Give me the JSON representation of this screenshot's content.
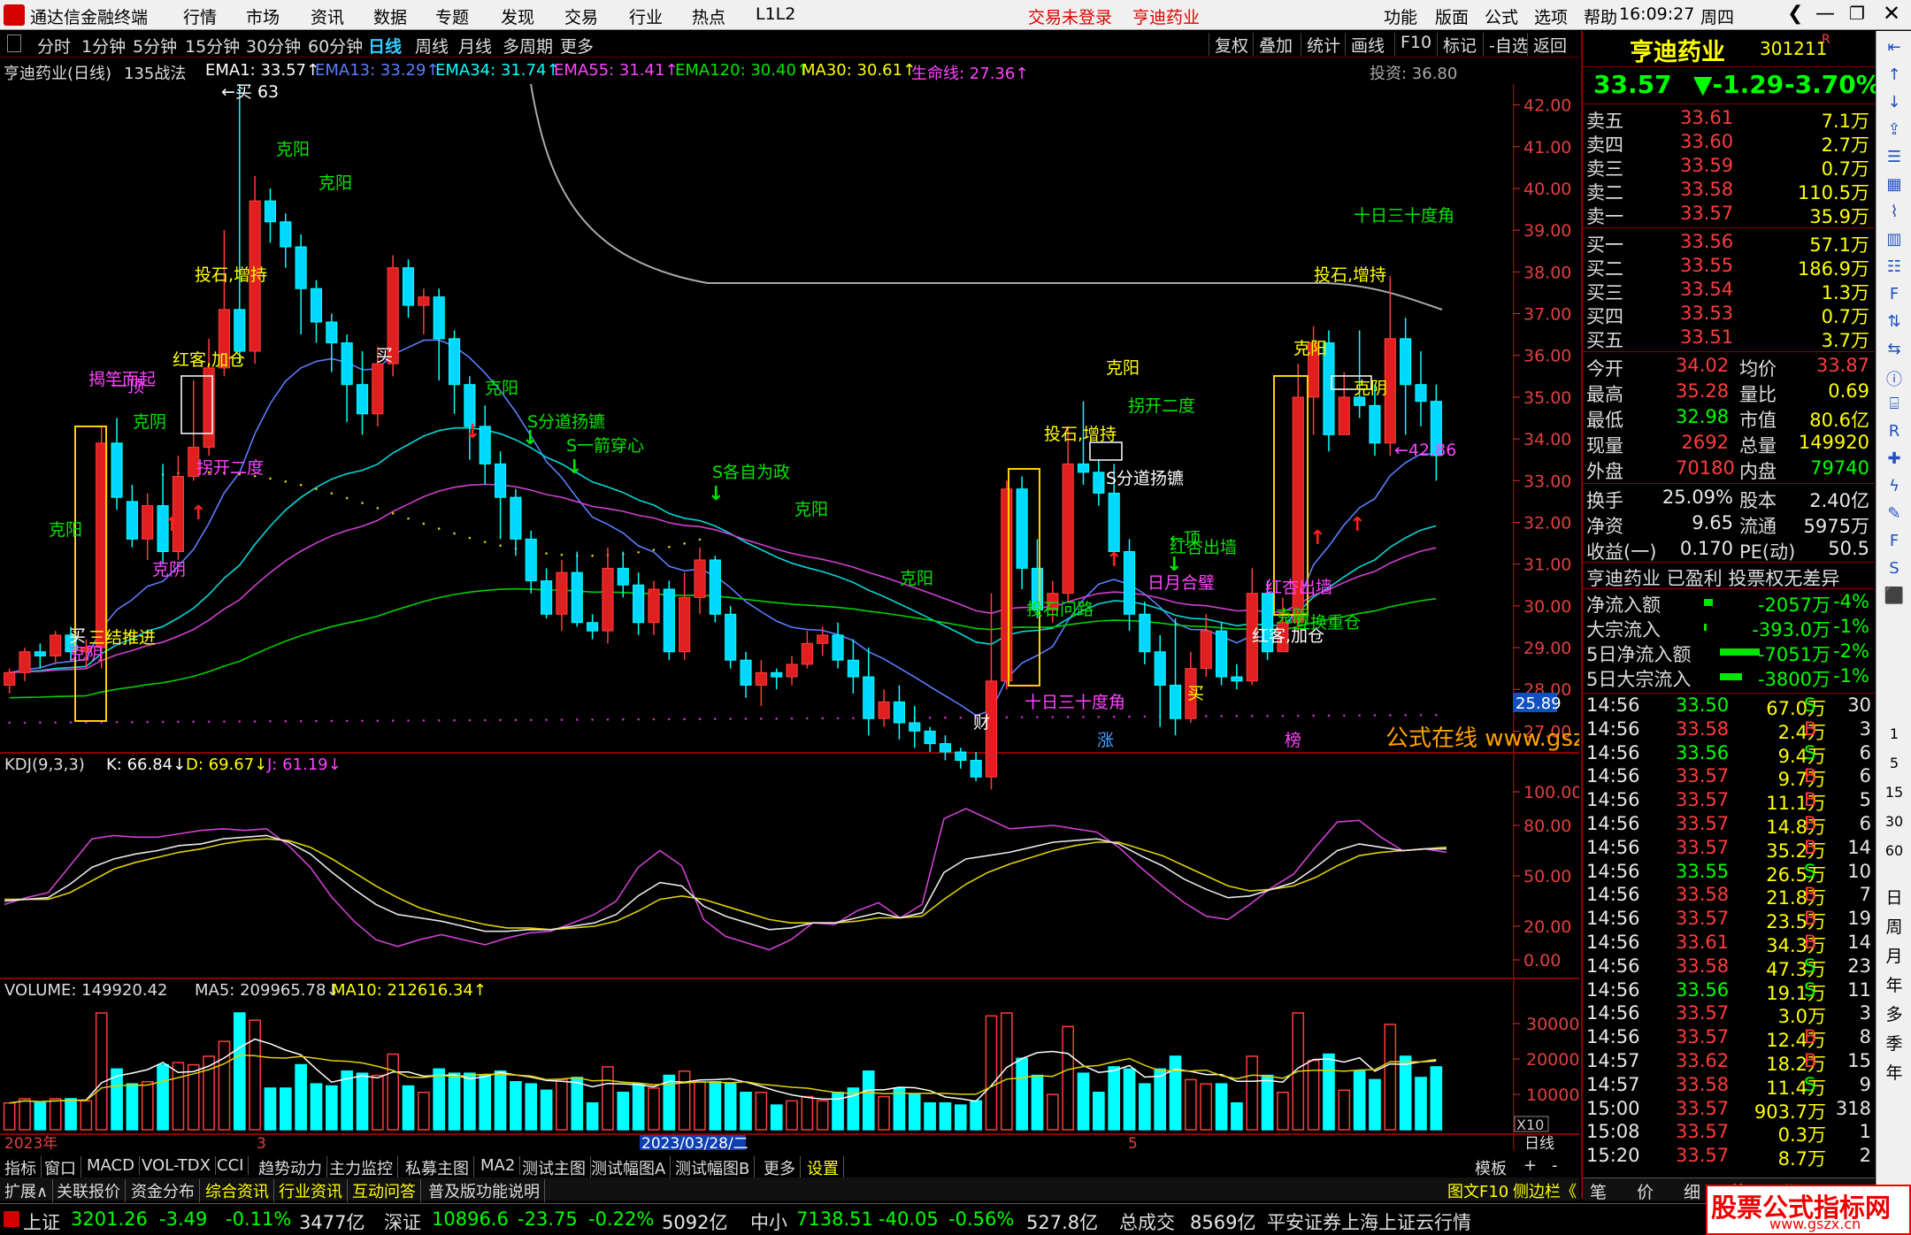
{
  "titlebar": {
    "app_name": "通达信金融终端",
    "menus": [
      "行情",
      "市场",
      "资讯",
      "数据",
      "专题",
      "发现",
      "交易",
      "行业",
      "热点",
      "L1L2"
    ],
    "trade_status": "交易未登录",
    "stock_name": "亨迪药业",
    "right_menus": [
      "功能",
      "版面",
      "公式",
      "选项",
      "帮助"
    ],
    "time": "16:09:27",
    "weekday": "周四"
  },
  "period_tabs": [
    "分时",
    "1分钟",
    "5分钟",
    "15分钟",
    "30分钟",
    "60分钟",
    "日线",
    "周线",
    "月线",
    "多周期",
    "更多"
  ],
  "active_period": "日线",
  "tool_buttons": [
    "复权",
    "叠加",
    "统计",
    "画线",
    "F10",
    "标记",
    "-自选",
    "返回"
  ],
  "main_indicators": {
    "stock_label": "亨迪药业(日线)",
    "formula": "135战法",
    "items": [
      {
        "label": "EMA1: 33.57",
        "color": "#ffffff"
      },
      {
        "label": "EMA13: 33.29",
        "color": "#5b7dff"
      },
      {
        "label": "EMA34: 31.74",
        "color": "#00ffff"
      },
      {
        "label": "EMA55: 31.41",
        "color": "#ff44ff"
      },
      {
        "label": "EMA120: 30.40",
        "color": "#00e600"
      },
      {
        "label": "MA30: 30.61",
        "color": "#ffff00"
      },
      {
        "label": "生命线: 27.36",
        "color": "#ff44ff"
      }
    ],
    "invest_label": "投资: 36.80"
  },
  "price_axis": [
    "42.00",
    "41.00",
    "40.00",
    "39.00",
    "38.00",
    "37.00",
    "36.00",
    "35.00",
    "34.00",
    "33.00",
    "32.00",
    "31.00",
    "30.00",
    "29.00",
    "28.00",
    "27.00"
  ],
  "current_price_tag": "25.89",
  "kdj": {
    "label": "KDJ(9,3,3)",
    "k": "K: 66.84",
    "d": "D: 69.67",
    "j": "J: 61.19",
    "axis": [
      "100.00",
      "80.00",
      "50.00",
      "20.00",
      "0.00"
    ]
  },
  "volume": {
    "label": "VOLUME: 149920.42",
    "ma5": "MA5: 209965.78",
    "ma10": "MA10: 212616.34",
    "axis": [
      "30000",
      "20000",
      "10000"
    ],
    "unit": "X10"
  },
  "x_axis": {
    "labels": [
      "2023年",
      "3",
      "2023/03/28/二",
      "5"
    ],
    "right_label": "日线"
  },
  "chart_annotations": [
    "克阳",
    "克阳",
    "投石,增持",
    "红客,加仓",
    "揭竿而起",
    "一顶",
    "克阴",
    "拐开二度",
    "克阳",
    "克阴",
    "克阳",
    "S分道扬镳",
    "S一箭穿心",
    "S各自为政",
    "克阳",
    "买",
    "买",
    "三结推进",
    "十日三十度角",
    "克阴",
    "克阳",
    "←顶",
    "投石,增持",
    "克阳",
    "拐开二度",
    "S分道扬镳",
    "红杏出墙",
    "投石问路",
    "日月合璧",
    "买",
    "红客,加仓",
    "投石,增持",
    "克阳",
    "十日三十度角",
    "红杏出墙",
    "克阴",
    "互换重仓",
    "克阴",
    "←42.86",
    "←买 63",
    "财",
    "涨",
    "榜",
    "公式在线  www.gszxan.cn"
  ],
  "right_panel": {
    "name": "亨迪药业",
    "code": "301211",
    "badge": "R",
    "price": "33.57",
    "change": "▼-1.29",
    "pct": "-3.70%",
    "asks": [
      {
        "label": "卖五",
        "price": "33.61",
        "vol": "7.1万"
      },
      {
        "label": "卖四",
        "price": "33.60",
        "vol": "2.7万"
      },
      {
        "label": "卖三",
        "price": "33.59",
        "vol": "0.7万"
      },
      {
        "label": "卖二",
        "price": "33.58",
        "vol": "110.5万"
      },
      {
        "label": "卖一",
        "price": "33.57",
        "vol": "35.9万"
      }
    ],
    "bids": [
      {
        "label": "买一",
        "price": "33.56",
        "vol": "57.1万"
      },
      {
        "label": "买二",
        "price": "33.55",
        "vol": "186.9万"
      },
      {
        "label": "买三",
        "price": "33.54",
        "vol": "1.3万"
      },
      {
        "label": "买四",
        "price": "33.53",
        "vol": "0.7万"
      },
      {
        "label": "买五",
        "price": "33.51",
        "vol": "3.7万"
      }
    ],
    "stats": [
      {
        "l1": "今开",
        "v1": "34.02",
        "l2": "均价",
        "v2": "33.87"
      },
      {
        "l1": "最高",
        "v1": "35.28",
        "l2": "量比",
        "v2": "0.69"
      },
      {
        "l1": "最低",
        "v1": "32.98",
        "l2": "市值",
        "v2": "80.6亿"
      },
      {
        "l1": "现量",
        "v1": "2692",
        "l2": "总量",
        "v2": "149920"
      },
      {
        "l1": "外盘",
        "v1": "70180",
        "l2": "内盘",
        "v2": "79740"
      }
    ],
    "stats2": [
      {
        "l1": "换手",
        "v1": "25.09%",
        "l2": "股本",
        "v2": "2.40亿"
      },
      {
        "l1": "净资",
        "v1": "9.65",
        "l2": "流通",
        "v2": "5975万"
      },
      {
        "l1": "收益(一)",
        "v1": "0.170",
        "l2": "PE(动)",
        "v2": "50.5"
      }
    ],
    "info_line": "亨迪药业 已盈利 投票权无差异",
    "flows": [
      {
        "label": "净流入额",
        "val": "-2057万",
        "pct": "-4%"
      },
      {
        "label": "大宗流入",
        "val": "-393.0万",
        "pct": "-1%"
      },
      {
        "label": "5日净流入额",
        "val": "-7051万",
        "pct": "-2%"
      },
      {
        "label": "5日大宗流入",
        "val": "-3800万",
        "pct": "-1%"
      }
    ],
    "ticks": [
      {
        "t": "14:56",
        "p": "33.50",
        "v": "67.0万",
        "s": "S",
        "n": "30"
      },
      {
        "t": "14:56",
        "p": "33.58",
        "v": "2.4万",
        "s": "B",
        "n": "3"
      },
      {
        "t": "14:56",
        "p": "33.56",
        "v": "9.4万",
        "s": "S",
        "n": "6"
      },
      {
        "t": "14:56",
        "p": "33.57",
        "v": "9.7万",
        "s": "B",
        "n": "6"
      },
      {
        "t": "14:56",
        "p": "33.57",
        "v": "11.1万",
        "s": "B",
        "n": "5"
      },
      {
        "t": "14:56",
        "p": "33.57",
        "v": "14.8万",
        "s": "B",
        "n": "6"
      },
      {
        "t": "14:56",
        "p": "33.57",
        "v": "35.2万",
        "s": "B",
        "n": "14"
      },
      {
        "t": "14:56",
        "p": "33.55",
        "v": "26.5万",
        "s": "S",
        "n": "10"
      },
      {
        "t": "14:56",
        "p": "33.58",
        "v": "21.8万",
        "s": "B",
        "n": "7"
      },
      {
        "t": "14:56",
        "p": "33.57",
        "v": "23.5万",
        "s": "B",
        "n": "19"
      },
      {
        "t": "14:56",
        "p": "33.61",
        "v": "34.3万",
        "s": "B",
        "n": "14"
      },
      {
        "t": "14:56",
        "p": "33.58",
        "v": "47.3万",
        "s": "S",
        "n": "23"
      },
      {
        "t": "14:56",
        "p": "33.56",
        "v": "19.1万",
        "s": "S",
        "n": "11"
      },
      {
        "t": "14:56",
        "p": "33.57",
        "v": "3.0万",
        "s": "",
        "n": "3"
      },
      {
        "t": "14:56",
        "p": "33.57",
        "v": "12.4万",
        "s": "B",
        "n": "8"
      },
      {
        "t": "14:57",
        "p": "33.62",
        "v": "18.2万",
        "s": "B",
        "n": "15"
      },
      {
        "t": "14:57",
        "p": "33.58",
        "v": "11.4万",
        "s": "S",
        "n": "9"
      },
      {
        "t": "15:00",
        "p": "33.57",
        "v": "903.7万",
        "s": "",
        "n": "318"
      },
      {
        "t": "15:08",
        "p": "33.57",
        "v": "0.3万",
        "s": "",
        "n": "1"
      },
      {
        "t": "15:20",
        "p": "33.57",
        "v": "8.7万",
        "s": "",
        "n": "2"
      }
    ],
    "bottom_tabs": [
      "笔",
      "价",
      "细",
      "势",
      "联"
    ]
  },
  "sidebar_labels": [
    "日",
    "周",
    "月",
    "年",
    "多",
    "季",
    "年"
  ],
  "sidebar_nums": [
    "1",
    "5",
    "15",
    "30",
    "60"
  ],
  "bottom_tabs": [
    "指标",
    "窗口",
    "MACD",
    "VOL-TDX",
    "CCI",
    "趋势动力",
    "主力监控",
    "私募主图",
    "MA2",
    "测试主图",
    "测试幅图A",
    "测试幅图B",
    "更多",
    "设置"
  ],
  "bottom_right": [
    "模板",
    "+",
    "-"
  ],
  "bottom_tabs2": [
    "扩展∧",
    "关联报价",
    "资金分布",
    "综合资讯",
    "行业资讯",
    "互动问答",
    "普及版功能说明"
  ],
  "bottom_tabs2_right": [
    "图文F10",
    "侧边栏《"
  ],
  "status": {
    "sh_label": "上证",
    "sh_val": "3201.26",
    "sh_chg": "-3.49",
    "sh_pct": "-0.11%",
    "sh_amt": "3477亿",
    "sz_label": "深证",
    "sz_val": "10896.6",
    "sz_chg": "-23.75",
    "sz_pct": "-0.22%",
    "sz_amt": "5092亿",
    "zx_label": "中小",
    "zx_val": "7138.51",
    "zx_chg": "-40.05",
    "zx_pct": "-0.56%",
    "zx_amt": "527.8亿",
    "total_label": "总成交",
    "total_val": "8569亿",
    "broker": "平安证券上海上证云行情",
    "watermark": "股票公式指标网",
    "watermark_url": "www.gszx.cn"
  },
  "colors": {
    "up": "#ff3c3c",
    "down": "#00ffff",
    "grid": "#8b0000"
  },
  "chart_data": {
    "type": "candlestick",
    "ylim": [
      26.5,
      42.5
    ],
    "candles": [
      [
        28.1,
        28.4,
        28.5,
        27.9
      ],
      [
        28.4,
        28.9,
        29.0,
        28.2
      ],
      [
        28.9,
        28.8,
        29.1,
        28.5
      ],
      [
        28.8,
        29.3,
        29.4,
        28.6
      ],
      [
        29.3,
        28.9,
        29.5,
        28.7
      ],
      [
        28.9,
        29.0,
        29.2,
        28.5
      ],
      [
        29.0,
        33.9,
        34.3,
        28.5
      ],
      [
        33.9,
        32.6,
        34.5,
        32.3
      ],
      [
        32.5,
        31.6,
        32.9,
        31.4
      ],
      [
        31.6,
        32.4,
        32.7,
        31.1
      ],
      [
        32.4,
        31.3,
        33.4,
        31.0
      ],
      [
        31.3,
        33.1,
        33.6,
        31.1
      ],
      [
        33.1,
        33.8,
        35.4,
        33.0
      ],
      [
        33.8,
        35.7,
        36.4,
        33.6
      ],
      [
        35.7,
        37.1,
        39.0,
        35.5
      ],
      [
        37.1,
        36.1,
        42.5,
        35.8
      ],
      [
        36.1,
        39.7,
        40.3,
        35.8
      ],
      [
        39.7,
        39.2,
        40.0,
        38.7
      ],
      [
        39.2,
        38.6,
        39.4,
        38.1
      ],
      [
        38.6,
        37.6,
        38.9,
        36.5
      ],
      [
        37.6,
        36.8,
        37.8,
        36.3
      ],
      [
        36.8,
        36.3,
        37.0,
        35.6
      ],
      [
        36.3,
        35.3,
        36.5,
        34.4
      ],
      [
        35.3,
        34.6,
        36.1,
        34.1
      ],
      [
        34.6,
        35.8,
        36.2,
        34.3
      ],
      [
        35.8,
        38.1,
        38.4,
        35.5
      ],
      [
        38.1,
        37.2,
        38.3,
        36.9
      ],
      [
        37.2,
        37.4,
        37.6,
        36.5
      ],
      [
        37.4,
        36.4,
        37.6,
        35.4
      ],
      [
        36.4,
        35.3,
        36.6,
        34.6
      ],
      [
        35.3,
        34.3,
        35.5,
        33.5
      ],
      [
        34.3,
        33.4,
        34.8,
        32.9
      ],
      [
        33.4,
        32.6,
        33.7,
        31.6
      ],
      [
        32.6,
        31.6,
        32.8,
        31.2
      ],
      [
        31.6,
        30.6,
        31.8,
        30.3
      ],
      [
        30.6,
        29.8,
        30.9,
        29.7
      ],
      [
        29.8,
        30.8,
        31.1,
        29.4
      ],
      [
        30.8,
        29.6,
        31.3,
        29.5
      ],
      [
        29.6,
        29.4,
        29.8,
        29.2
      ],
      [
        29.4,
        30.9,
        31.4,
        29.1
      ],
      [
        30.9,
        30.5,
        31.3,
        30.2
      ],
      [
        30.5,
        29.6,
        30.8,
        29.3
      ],
      [
        29.6,
        30.4,
        30.6,
        29.3
      ],
      [
        30.4,
        28.9,
        30.6,
        28.7
      ],
      [
        28.9,
        30.2,
        30.8,
        28.7
      ],
      [
        30.2,
        31.1,
        31.4,
        29.8
      ],
      [
        31.1,
        29.8,
        31.2,
        29.6
      ],
      [
        29.8,
        28.7,
        30.0,
        28.5
      ],
      [
        28.7,
        28.1,
        28.9,
        27.8
      ],
      [
        28.1,
        28.4,
        28.7,
        27.6
      ],
      [
        28.4,
        28.3,
        28.5,
        28.0
      ],
      [
        28.3,
        28.6,
        28.8,
        28.1
      ],
      [
        28.6,
        29.1,
        29.4,
        28.5
      ],
      [
        29.1,
        29.3,
        29.5,
        28.8
      ],
      [
        29.3,
        28.7,
        29.6,
        28.5
      ],
      [
        28.7,
        28.3,
        29.2,
        27.9
      ],
      [
        28.3,
        27.3,
        29.0,
        26.9
      ],
      [
        27.3,
        27.7,
        28.0,
        27.1
      ],
      [
        27.7,
        27.2,
        28.1,
        26.8
      ],
      [
        27.2,
        27.0,
        27.6,
        26.6
      ],
      [
        27.0,
        26.7,
        27.1,
        26.5
      ],
      [
        26.7,
        26.5,
        26.9,
        26.3
      ],
      [
        26.5,
        26.3,
        26.6,
        26.1
      ],
      [
        26.3,
        25.9,
        26.5,
        25.8
      ],
      [
        25.9,
        28.2,
        30.3,
        25.6
      ],
      [
        28.2,
        32.8,
        33.0,
        28.0
      ],
      [
        32.8,
        30.9,
        33.1,
        30.4
      ],
      [
        30.9,
        29.9,
        31.6,
        29.7
      ],
      [
        29.9,
        30.3,
        30.6,
        29.6
      ],
      [
        30.3,
        33.4,
        34.3,
        30.1
      ],
      [
        33.4,
        33.2,
        34.9,
        32.9
      ],
      [
        33.2,
        32.7,
        33.5,
        32.4
      ],
      [
        32.7,
        31.3,
        33.4,
        31.1
      ],
      [
        31.3,
        29.8,
        31.6,
        29.4
      ],
      [
        29.8,
        28.9,
        30.1,
        28.6
      ],
      [
        28.9,
        28.1,
        29.3,
        27.1
      ],
      [
        28.1,
        27.3,
        29.7,
        26.9
      ],
      [
        27.3,
        28.5,
        28.9,
        27.2
      ],
      [
        28.5,
        29.4,
        29.8,
        28.3
      ],
      [
        29.4,
        28.3,
        29.6,
        28.1
      ],
      [
        28.3,
        28.2,
        28.6,
        28.0
      ],
      [
        28.2,
        30.3,
        30.9,
        28.1
      ],
      [
        30.3,
        28.9,
        30.6,
        28.7
      ],
      [
        28.9,
        29.6,
        30.2,
        29.1
      ],
      [
        29.6,
        35.0,
        35.8,
        29.2
      ],
      [
        35.0,
        36.3,
        36.7,
        34.1
      ],
      [
        36.3,
        34.1,
        36.6,
        33.7
      ],
      [
        34.1,
        35.0,
        35.6,
        34.4
      ],
      [
        35.0,
        34.8,
        36.6,
        34.5
      ],
      [
        34.8,
        33.9,
        35.3,
        33.6
      ],
      [
        33.9,
        36.4,
        37.9,
        33.6
      ],
      [
        36.4,
        35.3,
        36.9,
        34.1
      ],
      [
        35.3,
        34.9,
        36.1,
        34.3
      ],
      [
        34.9,
        33.6,
        35.3,
        33.0
      ]
    ],
    "kdj_k": [
      35,
      36,
      37,
      45,
      55,
      60,
      63,
      65,
      68,
      69,
      72,
      73,
      74,
      70,
      63,
      52,
      42,
      33,
      27,
      25,
      23,
      20,
      17,
      17,
      18,
      18,
      20,
      22,
      27,
      38,
      46,
      44,
      32,
      26,
      22,
      18,
      19,
      22,
      22,
      25,
      28,
      25,
      28,
      52,
      60,
      62,
      64,
      67,
      70,
      71,
      72,
      69,
      62,
      56,
      48,
      42,
      37,
      38,
      42,
      46,
      55,
      65,
      69,
      67,
      65,
      66,
      66
    ],
    "kdj_d": [
      36,
      36,
      36,
      40,
      47,
      54,
      58,
      61,
      64,
      66,
      69,
      71,
      72,
      71,
      67,
      60,
      52,
      44,
      37,
      31,
      27,
      24,
      21,
      19,
      19,
      18,
      19,
      20,
      23,
      29,
      36,
      38,
      36,
      32,
      28,
      24,
      22,
      22,
      22,
      23,
      25,
      25,
      26,
      36,
      45,
      52,
      57,
      61,
      65,
      68,
      70,
      70,
      66,
      62,
      56,
      50,
      44,
      41,
      42,
      44,
      49,
      56,
      62,
      64,
      65,
      66,
      67
    ],
    "kdj_j": [
      33,
      37,
      40,
      56,
      72,
      74,
      73,
      73,
      75,
      77,
      78,
      77,
      78,
      68,
      55,
      37,
      23,
      12,
      8,
      12,
      15,
      12,
      9,
      13,
      16,
      17,
      22,
      27,
      35,
      55,
      65,
      56,
      24,
      14,
      10,
      6,
      12,
      22,
      21,
      29,
      34,
      25,
      33,
      84,
      90,
      84,
      78,
      79,
      80,
      78,
      76,
      67,
      55,
      44,
      34,
      26,
      24,
      33,
      43,
      51,
      67,
      82,
      83,
      73,
      65,
      66,
      64
    ]
  }
}
